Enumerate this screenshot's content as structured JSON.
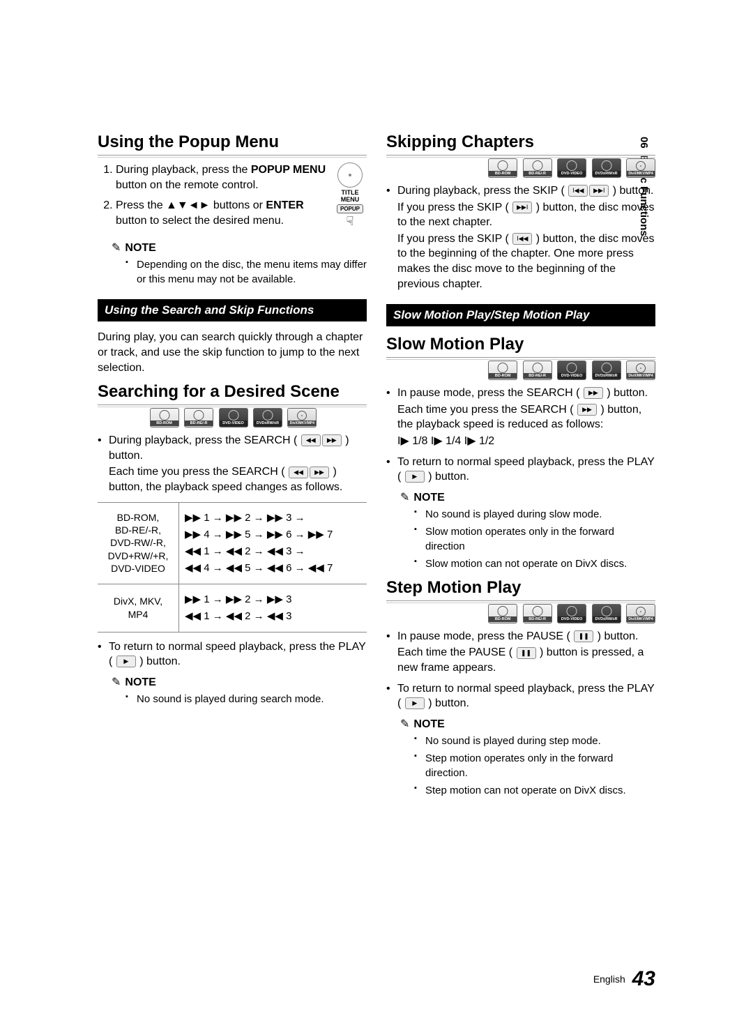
{
  "side_tab": {
    "number": "06",
    "label": "Basic Functions"
  },
  "footer": {
    "lang": "English",
    "page": "43"
  },
  "badges": [
    "BD-ROM",
    "BD-RE/-R",
    "DVD-VIDEO",
    "DVD±RW/±R",
    "DivX/MKV/MP4"
  ],
  "left": {
    "h_popup": "Using the Popup Menu",
    "remote": {
      "title_menu": "TITLE MENU",
      "popup": "POPUP"
    },
    "steps": [
      "During playback, press the POPUP MENU button on the remote control.",
      "Press the ▲▼◄► buttons or ENTER button to select the desired menu."
    ],
    "note_label": "NOTE",
    "popup_note": "Depending on the disc, the menu items may differ or this menu may not be available.",
    "bar_search": "Using the Search and Skip Functions",
    "search_intro": "During play, you can search quickly through a chapter or track, and use the skip function to jump to the next selection.",
    "h_search_scene": "Searching for a Desired Scene",
    "search_bullet1a": "During playback, press the SEARCH (",
    "search_bullet1b": ") button.",
    "search_line2a": "Each time you press the SEARCH (",
    "search_line2b": ") button, the playback speed changes as follows.",
    "speed_table": {
      "row1_label": "BD-ROM,\nBD-RE/-R,\nDVD-RW/-R,\nDVD+RW/+R,\nDVD-VIDEO",
      "row1_val": "▶▶ 1 → ▶▶ 2 → ▶▶ 3 →\n▶▶ 4 → ▶▶ 5 → ▶▶ 6 → ▶▶ 7\n◀◀ 1 → ◀◀ 2 → ◀◀ 3 →\n◀◀ 4 → ◀◀ 5 → ◀◀ 6 → ◀◀ 7",
      "row2_label": "DivX, MKV, MP4",
      "row2_val": "▶▶ 1 → ▶▶ 2 → ▶▶ 3\n◀◀ 1 → ◀◀ 2 → ◀◀ 3"
    },
    "return_normal_a": "To return to normal speed playback, press the PLAY (",
    "return_normal_b": ") button.",
    "search_note": "No sound is played during search mode."
  },
  "right": {
    "h_skip": "Skipping Chapters",
    "skip_b1a": "During playback, press the SKIP (",
    "skip_b1b": ") button.",
    "skip_line2a": "If you press the SKIP (",
    "skip_line2b": ") button, the disc moves to the next chapter.",
    "skip_line3a": "If you press the SKIP (",
    "skip_line3b": ") button, the disc moves to the beginning of the chapter. One more press makes the disc move to the beginning of the previous chapter.",
    "bar_slow": "Slow Motion Play/Step Motion Play",
    "h_slow": "Slow Motion Play",
    "slow_b1a": "In pause mode, press the SEARCH (",
    "slow_b1b": ") button.",
    "slow_line2a": "Each time you press the SEARCH (",
    "slow_line2b": ") button, the playback speed is reduced as follows:",
    "slow_speeds": "I▶ 1/8  I▶ 1/4  I▶ 1/2",
    "slow_return_a": "To return to normal speed playback, press the PLAY (",
    "slow_return_b": ") button.",
    "note_label": "NOTE",
    "slow_notes": [
      "No sound is played during slow mode.",
      "Slow motion operates only in the forward direction",
      "Slow motion can not operate on DivX discs."
    ],
    "h_step": "Step Motion Play",
    "step_b1a": "In pause mode, press the PAUSE (",
    "step_b1b": ") button.",
    "step_line2a": "Each time the PAUSE (",
    "step_line2b": ") button is pressed, a new frame appears.",
    "step_return_a": "To return to normal speed playback, press the PLAY (",
    "step_return_b": ") button.",
    "step_notes": [
      "No sound is played during step mode.",
      "Step motion operates only in the forward direction.",
      "Step motion can not operate on DivX discs."
    ]
  },
  "btn": {
    "search_pair": "◀◀ ▶▶",
    "ff": "▶▶",
    "prev": "I◀◀",
    "next": "▶▶I",
    "play": "▶",
    "pause": "❚❚"
  }
}
